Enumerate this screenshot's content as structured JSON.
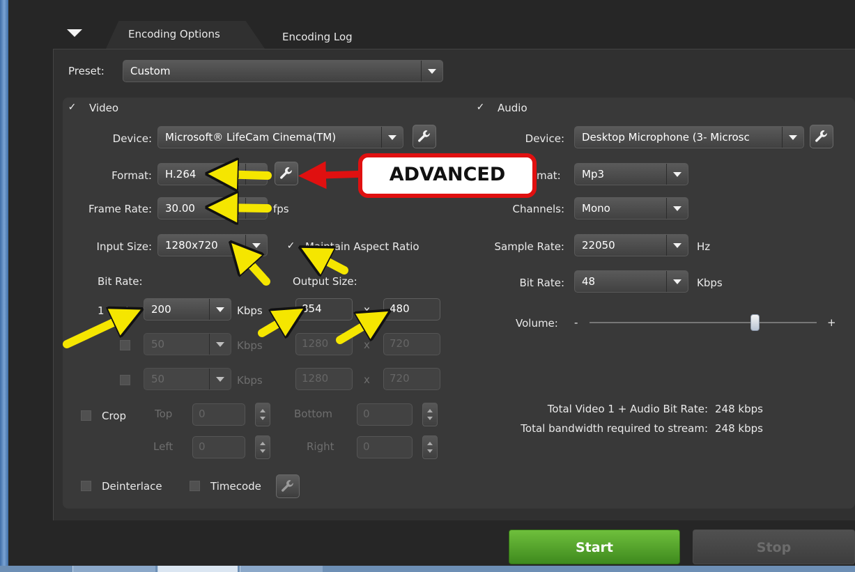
{
  "tabs": {
    "active": "Encoding Options",
    "inactive": "Encoding Log"
  },
  "preset": {
    "label": "Preset:",
    "value": "Custom"
  },
  "video": {
    "checkbox_label": "Video",
    "device_label": "Device:",
    "device_value": "Microsoft® LifeCam Cinema(TM)",
    "format_label": "Format:",
    "format_value": "H.264",
    "frame_rate_label": "Frame Rate:",
    "frame_rate_value": "30.00",
    "frame_rate_unit": "fps",
    "input_size_label": "Input Size:",
    "input_size_value": "1280x720",
    "maintain_aspect_label": "Maintain Aspect Ratio",
    "bit_rate_label": "Bit Rate:",
    "output_size_label": "Output Size:",
    "rows": [
      {
        "index": "1",
        "bitrate": "200",
        "unit": "Kbps",
        "width": "854",
        "sep": "x",
        "height": "480"
      },
      {
        "bitrate": "50",
        "unit": "Kbps",
        "width": "1280",
        "sep": "x",
        "height": "720"
      },
      {
        "bitrate": "50",
        "unit": "Kbps",
        "width": "1280",
        "sep": "x",
        "height": "720"
      }
    ],
    "crop_label": "Crop",
    "crop_top_label": "Top",
    "crop_top_value": "0",
    "crop_bottom_label": "Bottom",
    "crop_bottom_value": "0",
    "crop_left_label": "Left",
    "crop_left_value": "0",
    "crop_right_label": "Right",
    "crop_right_value": "0",
    "deinterlace_label": "Deinterlace",
    "timecode_label": "Timecode"
  },
  "audio": {
    "checkbox_label": "Audio",
    "device_label": "Device:",
    "device_value": "Desktop Microphone (3- Microsc",
    "format_label_partial": "mat:",
    "format_value": "Mp3",
    "channels_label": "Channels:",
    "channels_value": "Mono",
    "sample_rate_label": "Sample Rate:",
    "sample_rate_value": "22050",
    "sample_rate_unit": "Hz",
    "bit_rate_label": "Bit Rate:",
    "bit_rate_value": "48",
    "bit_rate_unit": "Kbps",
    "volume_label": "Volume:",
    "volume_minus": "-",
    "volume_plus": "+",
    "volume_level": 0.73
  },
  "totals": {
    "line1_label": "Total Video 1 + Audio Bit Rate:",
    "line1_value": "248 kbps",
    "line2_label": "Total bandwidth required to stream:",
    "line2_value": "248 kbps"
  },
  "buttons": {
    "start": "Start",
    "stop": "Stop"
  },
  "annotation": {
    "callout_text": "ADVANCED",
    "callout_color": "#e01010",
    "arrow_color": "#f5e600"
  },
  "check_mark": "✓"
}
